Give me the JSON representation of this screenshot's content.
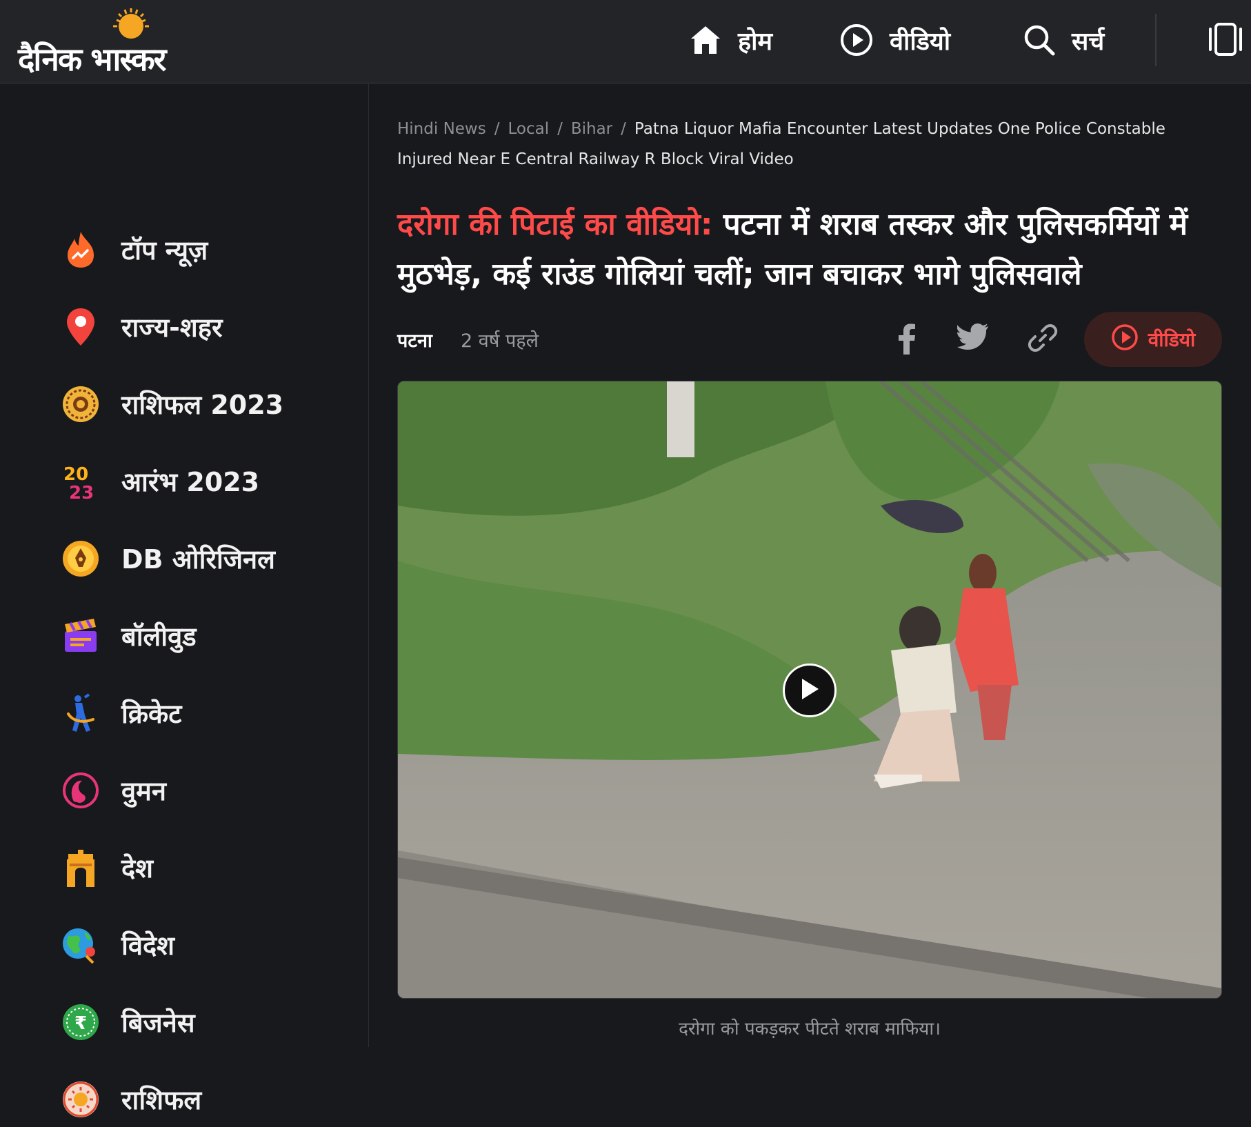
{
  "header": {
    "logo_text": "दैनिक भास्कर",
    "nav": {
      "home": "होम",
      "video": "वीडियो",
      "search": "सर्च"
    }
  },
  "sidebar": {
    "items": [
      {
        "label": "टॉप न्यूज़",
        "icon": "fire-trending-icon"
      },
      {
        "label": "राज्य-शहर",
        "icon": "location-pin-icon"
      },
      {
        "label": "राशिफल 2023",
        "icon": "zodiac-wheel-icon"
      },
      {
        "label": "आरंभ 2023",
        "icon": "year-2023-icon"
      },
      {
        "label": "DB ओरिजिनल",
        "icon": "pen-nib-icon"
      },
      {
        "label": "बॉलीवुड",
        "icon": "clapperboard-icon"
      },
      {
        "label": "क्रिकेट",
        "icon": "cricket-player-icon"
      },
      {
        "label": "वुमन",
        "icon": "woman-face-icon"
      },
      {
        "label": "देश",
        "icon": "india-gate-icon"
      },
      {
        "label": "विदेश",
        "icon": "globe-icon"
      },
      {
        "label": "बिजनेस",
        "icon": "rupee-coin-icon"
      },
      {
        "label": "राशिफल",
        "icon": "sun-zodiac-icon"
      }
    ]
  },
  "breadcrumb": {
    "items": [
      "Hindi News",
      "Local",
      "Bihar"
    ],
    "separator": "/",
    "current": "Patna Liquor Mafia Encounter Latest Updates One Police Constable Injured Near E Central Railway R Block Viral Video"
  },
  "article": {
    "kicker": "दरोगा की पिटाई का वीडियो:",
    "headline": "पटना में शराब तस्कर और पुलिसकर्मियों में मुठभेड़, कई राउंड गोलियां चलीं; जान बचाकर भागे पुलिसवाले",
    "city": "पटना",
    "time": "2 वर्ष पहले",
    "video_button": "वीडियो",
    "caption": "दरोगा को पकड़कर पीटते शराब माफिया।"
  },
  "colors": {
    "accent": "#ff4a4a",
    "background": "#18191c",
    "header": "#232427",
    "logo_sun": "#f5a623"
  }
}
